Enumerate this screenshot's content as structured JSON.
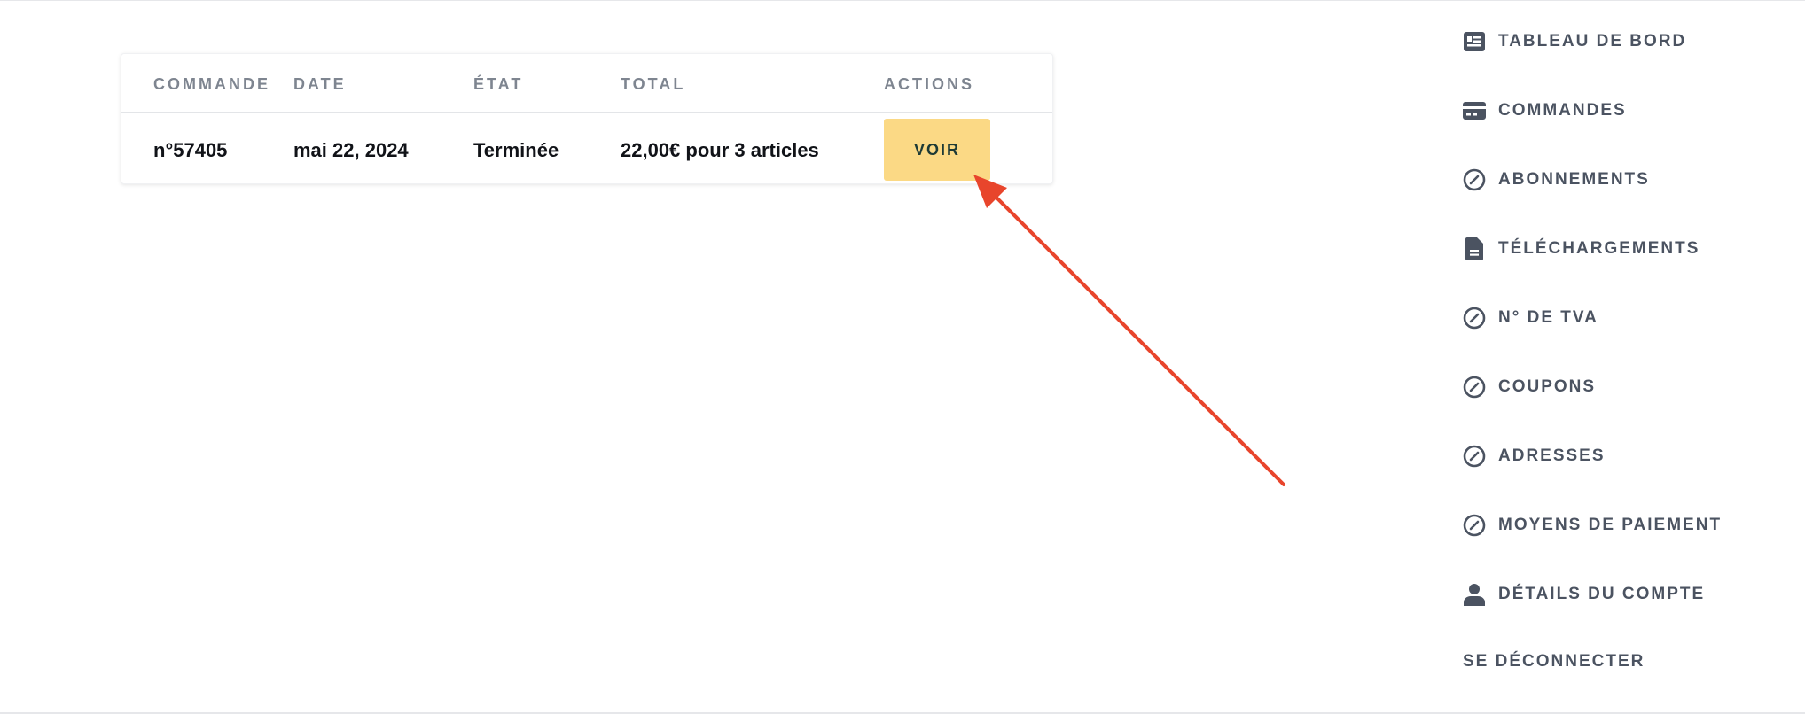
{
  "orders_table": {
    "columns": [
      "COMMANDE",
      "DATE",
      "ÉTAT",
      "TOTAL",
      "ACTIONS"
    ],
    "rows": [
      {
        "order": "n°57405",
        "date": "mai 22, 2024",
        "status": "Terminée",
        "total": "22,00€ pour 3 articles",
        "action_label": "VOIR"
      }
    ]
  },
  "nav": {
    "items": [
      {
        "label": "TABLEAU DE BORD",
        "icon": "dashboard-icon"
      },
      {
        "label": "COMMANDES",
        "icon": "credit-card-icon"
      },
      {
        "label": "ABONNEMENTS",
        "icon": "compass-icon"
      },
      {
        "label": "TÉLÉCHARGEMENTS",
        "icon": "document-icon"
      },
      {
        "label": "N° DE TVA",
        "icon": "compass-icon"
      },
      {
        "label": "COUPONS",
        "icon": "compass-icon"
      },
      {
        "label": "ADRESSES",
        "icon": "compass-icon"
      },
      {
        "label": "MOYENS DE PAIEMENT",
        "icon": "compass-icon"
      },
      {
        "label": "DÉTAILS DU COMPTE",
        "icon": "user-icon"
      },
      {
        "label": "SE DÉCONNECTER",
        "icon": ""
      }
    ]
  },
  "colors": {
    "button_bg": "#fbd985",
    "button_text": "#1d3a35",
    "arrow": "#e8452c",
    "nav_text": "#4b5361",
    "header_text": "#7e8590"
  }
}
